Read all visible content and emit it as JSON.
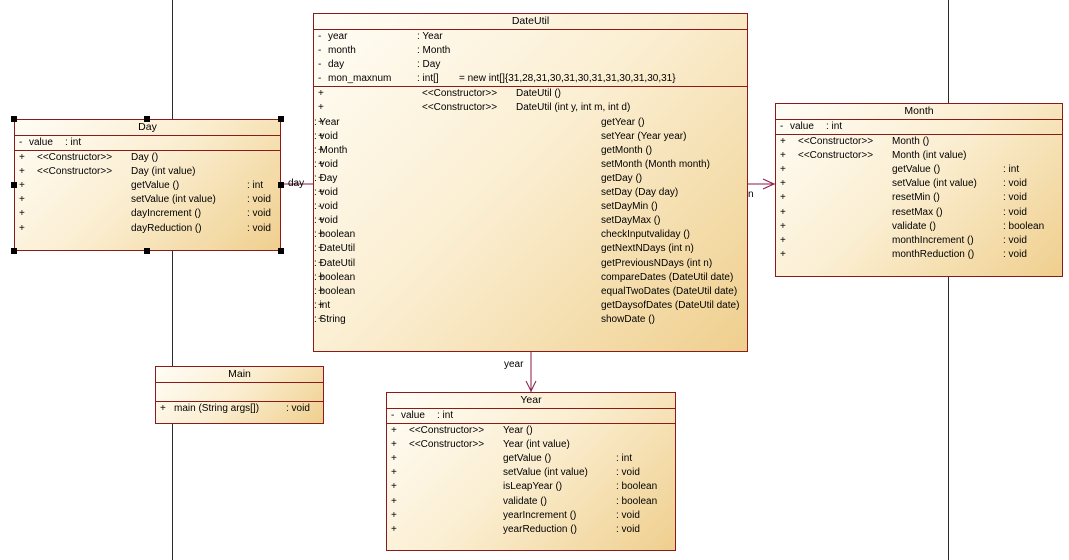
{
  "colors": {
    "border": "#8b1a1a",
    "association": "#8b1a4a",
    "fill_light": "#fffdf6",
    "fill_dark": "#efcf8e"
  },
  "classes": {
    "dateutil": {
      "name": "DateUtil",
      "attributes": [
        {
          "vis": "-",
          "name": "year",
          "type": ": Year"
        },
        {
          "vis": "-",
          "name": "month",
          "type": ": Month"
        },
        {
          "vis": "-",
          "name": "day",
          "type": ": Day"
        },
        {
          "vis": "-",
          "name": "mon_maxnum",
          "type": ": int[]",
          "init": "= new int[]{31,28,31,30,31,30,31,31,30,31,30,31}"
        }
      ],
      "operations": [
        {
          "vis": "+",
          "stereo": "<<Constructor>>",
          "name": "DateUtil ()",
          "ret": ""
        },
        {
          "vis": "+",
          "stereo": "<<Constructor>>",
          "name": "DateUtil (int y, int m, int d)",
          "ret": ""
        },
        {
          "vis": "+",
          "stereo": "",
          "name": "getYear ()",
          "ret": ": Year"
        },
        {
          "vis": "+",
          "stereo": "",
          "name": "setYear (Year year)",
          "ret": ": void"
        },
        {
          "vis": "+",
          "stereo": "",
          "name": "getMonth ()",
          "ret": ": Month"
        },
        {
          "vis": "+",
          "stereo": "",
          "name": "setMonth (Month month)",
          "ret": ": void"
        },
        {
          "vis": "+",
          "stereo": "",
          "name": "getDay ()",
          "ret": ": Day"
        },
        {
          "vis": "+",
          "stereo": "",
          "name": "setDay (Day day)",
          "ret": ": void"
        },
        {
          "vis": "-",
          "stereo": "",
          "name": "setDayMin ()",
          "ret": ": void"
        },
        {
          "vis": "+",
          "stereo": "",
          "name": "setDayMax ()",
          "ret": ": void"
        },
        {
          "vis": "+",
          "stereo": "",
          "name": "checkInputvaliday ()",
          "ret": ": boolean"
        },
        {
          "vis": "+",
          "stereo": "",
          "name": "getNextNDays (int n)",
          "ret": ": DateUtil"
        },
        {
          "vis": "+",
          "stereo": "",
          "name": "getPreviousNDays (int n)",
          "ret": ": DateUtil"
        },
        {
          "vis": "+",
          "stereo": "",
          "name": "compareDates (DateUtil date)",
          "ret": ": boolean"
        },
        {
          "vis": "+",
          "stereo": "",
          "name": "equalTwoDates (DateUtil date)",
          "ret": ": boolean"
        },
        {
          "vis": "+",
          "stereo": "",
          "name": "getDaysofDates (DateUtil date)",
          "ret": ": int"
        },
        {
          "vis": "+",
          "stereo": "",
          "name": "showDate ()",
          "ret": ": String"
        }
      ]
    },
    "day": {
      "name": "Day",
      "attributes": [
        {
          "vis": "-",
          "name": "value",
          "type": ": int"
        }
      ],
      "operations": [
        {
          "vis": "+",
          "stereo": "<<Constructor>>",
          "name": "Day ()",
          "ret": ""
        },
        {
          "vis": "+",
          "stereo": "<<Constructor>>",
          "name": "Day (int value)",
          "ret": ""
        },
        {
          "vis": "+",
          "stereo": "",
          "name": "getValue ()",
          "ret": ": int"
        },
        {
          "vis": "+",
          "stereo": "",
          "name": "setValue (int value)",
          "ret": ": void"
        },
        {
          "vis": "+",
          "stereo": "",
          "name": "dayIncrement ()",
          "ret": ": void"
        },
        {
          "vis": "+",
          "stereo": "",
          "name": "dayReduction ()",
          "ret": ": void"
        }
      ]
    },
    "month": {
      "name": "Month",
      "attributes": [
        {
          "vis": "-",
          "name": "value",
          "type": ": int"
        }
      ],
      "operations": [
        {
          "vis": "+",
          "stereo": "<<Constructor>>",
          "name": "Month ()",
          "ret": ""
        },
        {
          "vis": "+",
          "stereo": "<<Constructor>>",
          "name": "Month (int value)",
          "ret": ""
        },
        {
          "vis": "+",
          "stereo": "",
          "name": "getValue ()",
          "ret": ": int"
        },
        {
          "vis": "+",
          "stereo": "",
          "name": "setValue (int value)",
          "ret": ": void"
        },
        {
          "vis": "+",
          "stereo": "",
          "name": "resetMin ()",
          "ret": ": void"
        },
        {
          "vis": "+",
          "stereo": "",
          "name": "resetMax ()",
          "ret": ": void"
        },
        {
          "vis": "+",
          "stereo": "",
          "name": "validate ()",
          "ret": ": boolean"
        },
        {
          "vis": "+",
          "stereo": "",
          "name": "monthIncrement ()",
          "ret": ": void"
        },
        {
          "vis": "+",
          "stereo": "",
          "name": "monthReduction ()",
          "ret": ": void"
        }
      ]
    },
    "main": {
      "name": "Main",
      "attributes": [],
      "operations": [
        {
          "vis": "+",
          "stereo": "",
          "name": "main (String args[])",
          "ret": ": void"
        }
      ]
    },
    "year": {
      "name": "Year",
      "attributes": [
        {
          "vis": "-",
          "name": "value",
          "type": ": int"
        }
      ],
      "operations": [
        {
          "vis": "+",
          "stereo": "<<Constructor>>",
          "name": "Year ()",
          "ret": ""
        },
        {
          "vis": "+",
          "stereo": "<<Constructor>>",
          "name": "Year (int value)",
          "ret": ""
        },
        {
          "vis": "+",
          "stereo": "",
          "name": "getValue ()",
          "ret": ": int"
        },
        {
          "vis": "+",
          "stereo": "",
          "name": "setValue (int value)",
          "ret": ": void"
        },
        {
          "vis": "+",
          "stereo": "",
          "name": "isLeapYear ()",
          "ret": ": boolean"
        },
        {
          "vis": "+",
          "stereo": "",
          "name": "validate ()",
          "ret": ": boolean"
        },
        {
          "vis": "+",
          "stereo": "",
          "name": "yearIncrement ()",
          "ret": ": void"
        },
        {
          "vis": "+",
          "stereo": "",
          "name": "yearReduction ()",
          "ret": ": void"
        }
      ]
    }
  },
  "associations": {
    "day_label": "day",
    "month_label": "n",
    "year_label": "year"
  }
}
